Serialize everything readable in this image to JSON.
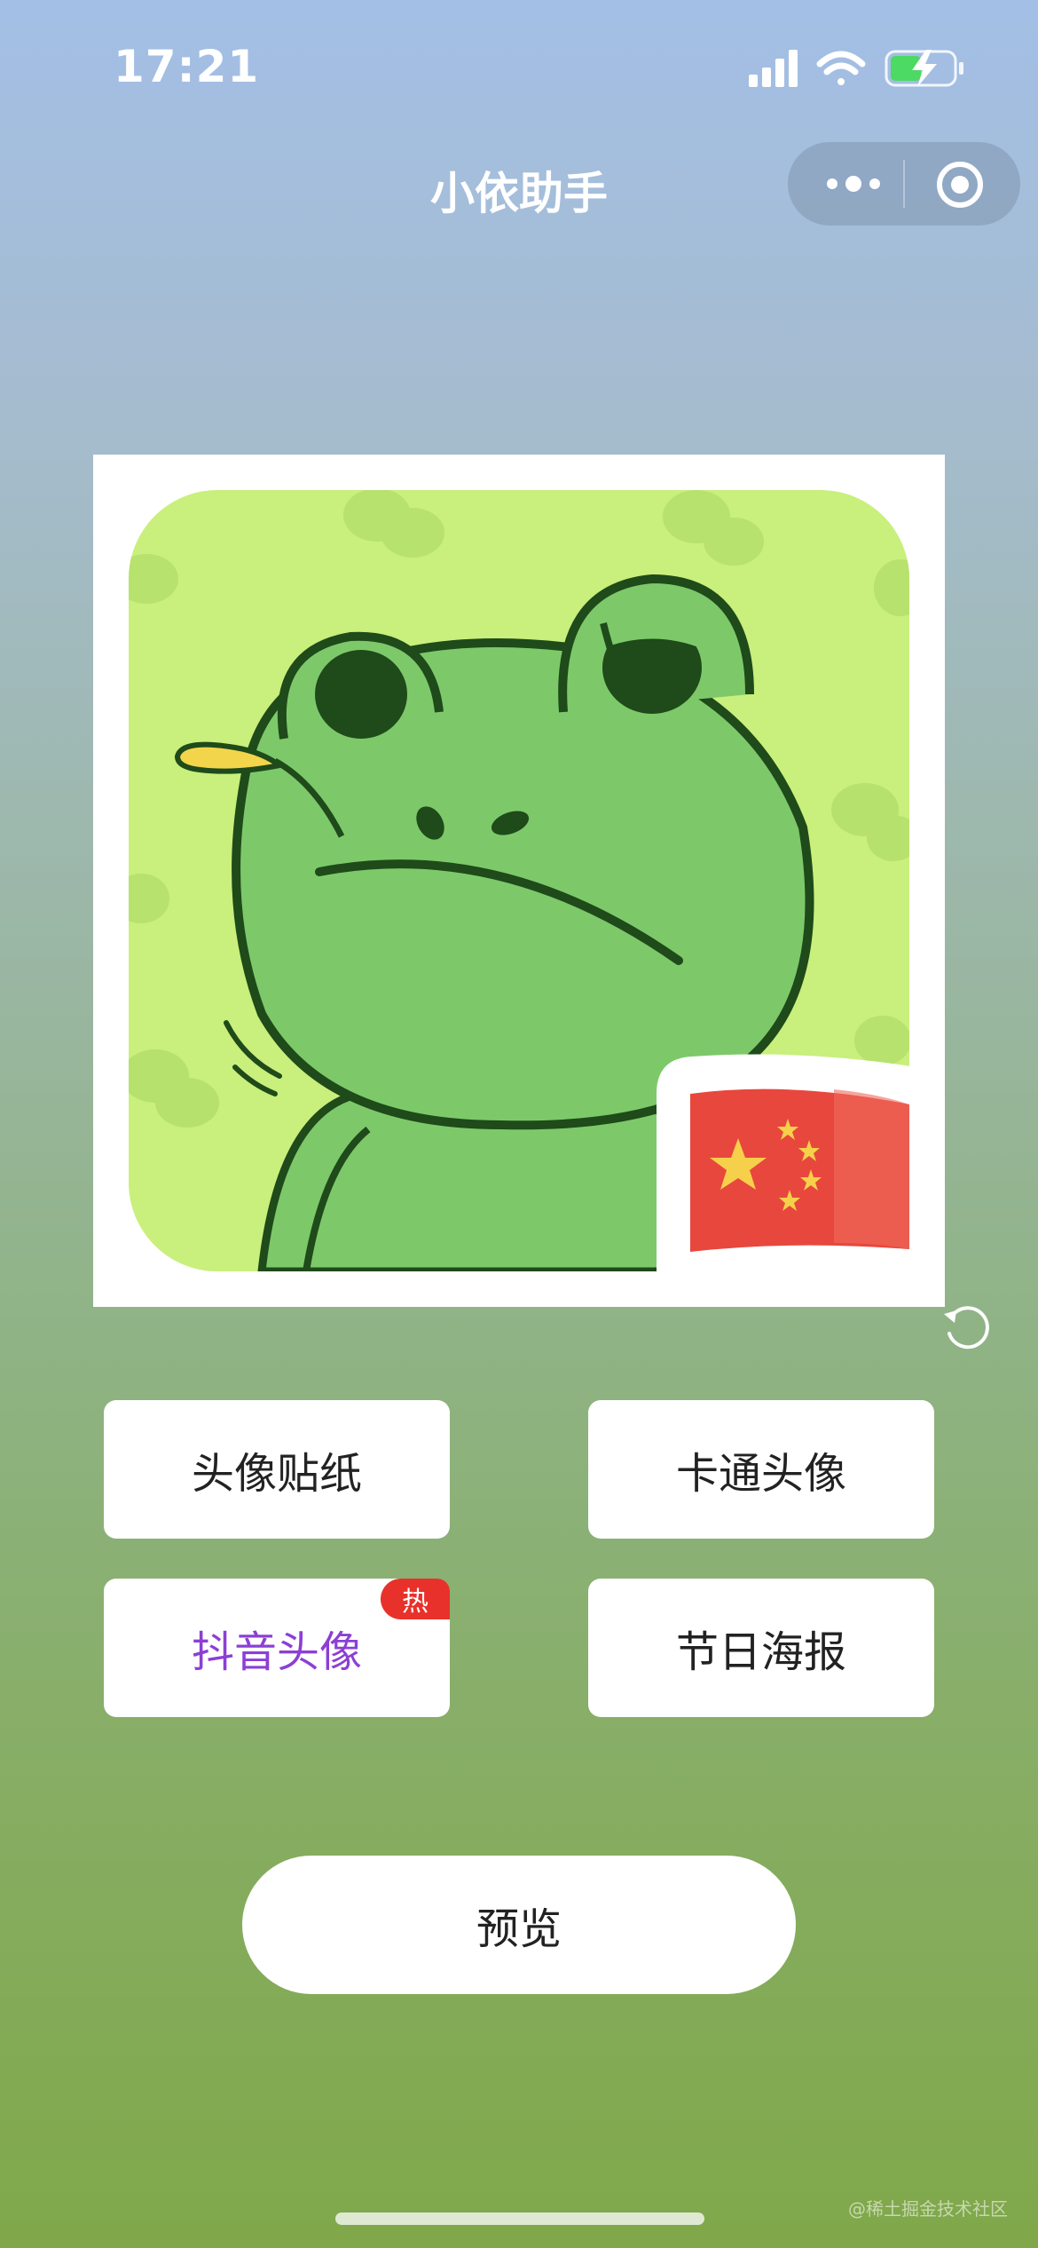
{
  "status_bar": {
    "time": "17:21",
    "icons": [
      "signal-icon",
      "wifi-icon",
      "battery-charging-icon"
    ]
  },
  "nav": {
    "title": "小依助手",
    "more_icon": "more-dots-icon",
    "close_icon": "target-circle-icon"
  },
  "editor": {
    "avatar_description": "cartoon-frog-avatar",
    "sticker": "china-flag-sticker",
    "rotate_icon": "rotate-icon"
  },
  "menu": {
    "items": [
      {
        "label": "头像贴纸",
        "active": false
      },
      {
        "label": "卡通头像",
        "active": false
      },
      {
        "label": "抖音头像",
        "active": true,
        "badge": "热"
      },
      {
        "label": "节日海报",
        "active": false
      }
    ]
  },
  "preview_button": {
    "label": "预览"
  },
  "watermark": "@稀土掘金技术社区",
  "colors": {
    "active_label": "#8c3fd4",
    "hot_badge": "#e8312a",
    "button_bg": "#ffffff"
  }
}
